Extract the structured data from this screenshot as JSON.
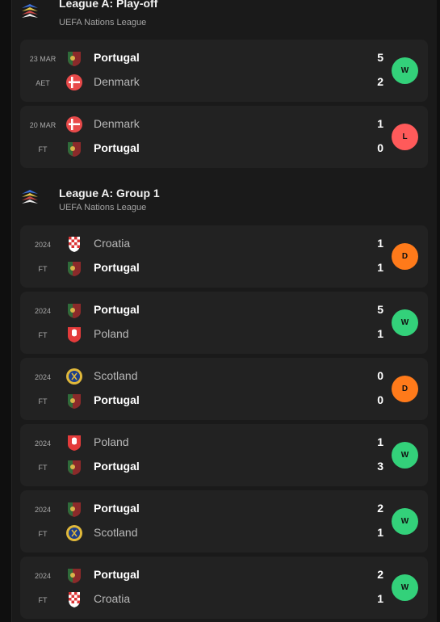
{
  "competitions": [
    {
      "title": "League A: Play-off",
      "subtitle": "UEFA Nations League",
      "icon": "uefa-nations-league-logo"
    },
    {
      "title": "League A: Group 1",
      "subtitle": "UEFA Nations League",
      "icon": "uefa-nations-league-logo"
    }
  ],
  "matches": [
    {
      "date": "23 MAR",
      "status": "AET",
      "home": "Portugal",
      "away": "Denmark",
      "home_score": "5",
      "away_score": "2",
      "result": "W",
      "home_flag": "portugal-flag",
      "away_flag": "denmark-flag"
    },
    {
      "date": "20 MAR",
      "status": "FT",
      "home": "Denmark",
      "away": "Portugal",
      "home_score": "1",
      "away_score": "0",
      "result": "L",
      "home_flag": "denmark-flag",
      "away_flag": "portugal-flag"
    },
    {
      "date": "2024",
      "status": "FT",
      "home": "Croatia",
      "away": "Portugal",
      "home_score": "1",
      "away_score": "1",
      "result": "D",
      "home_flag": "croatia-flag",
      "away_flag": "portugal-flag"
    },
    {
      "date": "2024",
      "status": "FT",
      "home": "Portugal",
      "away": "Poland",
      "home_score": "5",
      "away_score": "1",
      "result": "W",
      "home_flag": "portugal-flag",
      "away_flag": "poland-flag"
    },
    {
      "date": "2024",
      "status": "FT",
      "home": "Scotland",
      "away": "Portugal",
      "home_score": "0",
      "away_score": "0",
      "result": "D",
      "home_flag": "scotland-flag",
      "away_flag": "portugal-flag"
    },
    {
      "date": "2024",
      "status": "FT",
      "home": "Poland",
      "away": "Portugal",
      "home_score": "1",
      "away_score": "3",
      "result": "W",
      "home_flag": "poland-flag",
      "away_flag": "portugal-flag"
    },
    {
      "date": "2024",
      "status": "FT",
      "home": "Portugal",
      "away": "Scotland",
      "home_score": "2",
      "away_score": "1",
      "result": "W",
      "home_flag": "portugal-flag",
      "away_flag": "scotland-flag"
    },
    {
      "date": "2024",
      "status": "FT",
      "home": "Portugal",
      "away": "Croatia",
      "home_score": "2",
      "away_score": "1",
      "result": "W",
      "home_flag": "portugal-flag",
      "away_flag": "croatia-flag"
    }
  ],
  "colors": {
    "win": "#33d17a",
    "loss": "#ff5a5a",
    "draw": "#ff7a1a",
    "card": "#222222",
    "background": "#1a1a1a"
  }
}
